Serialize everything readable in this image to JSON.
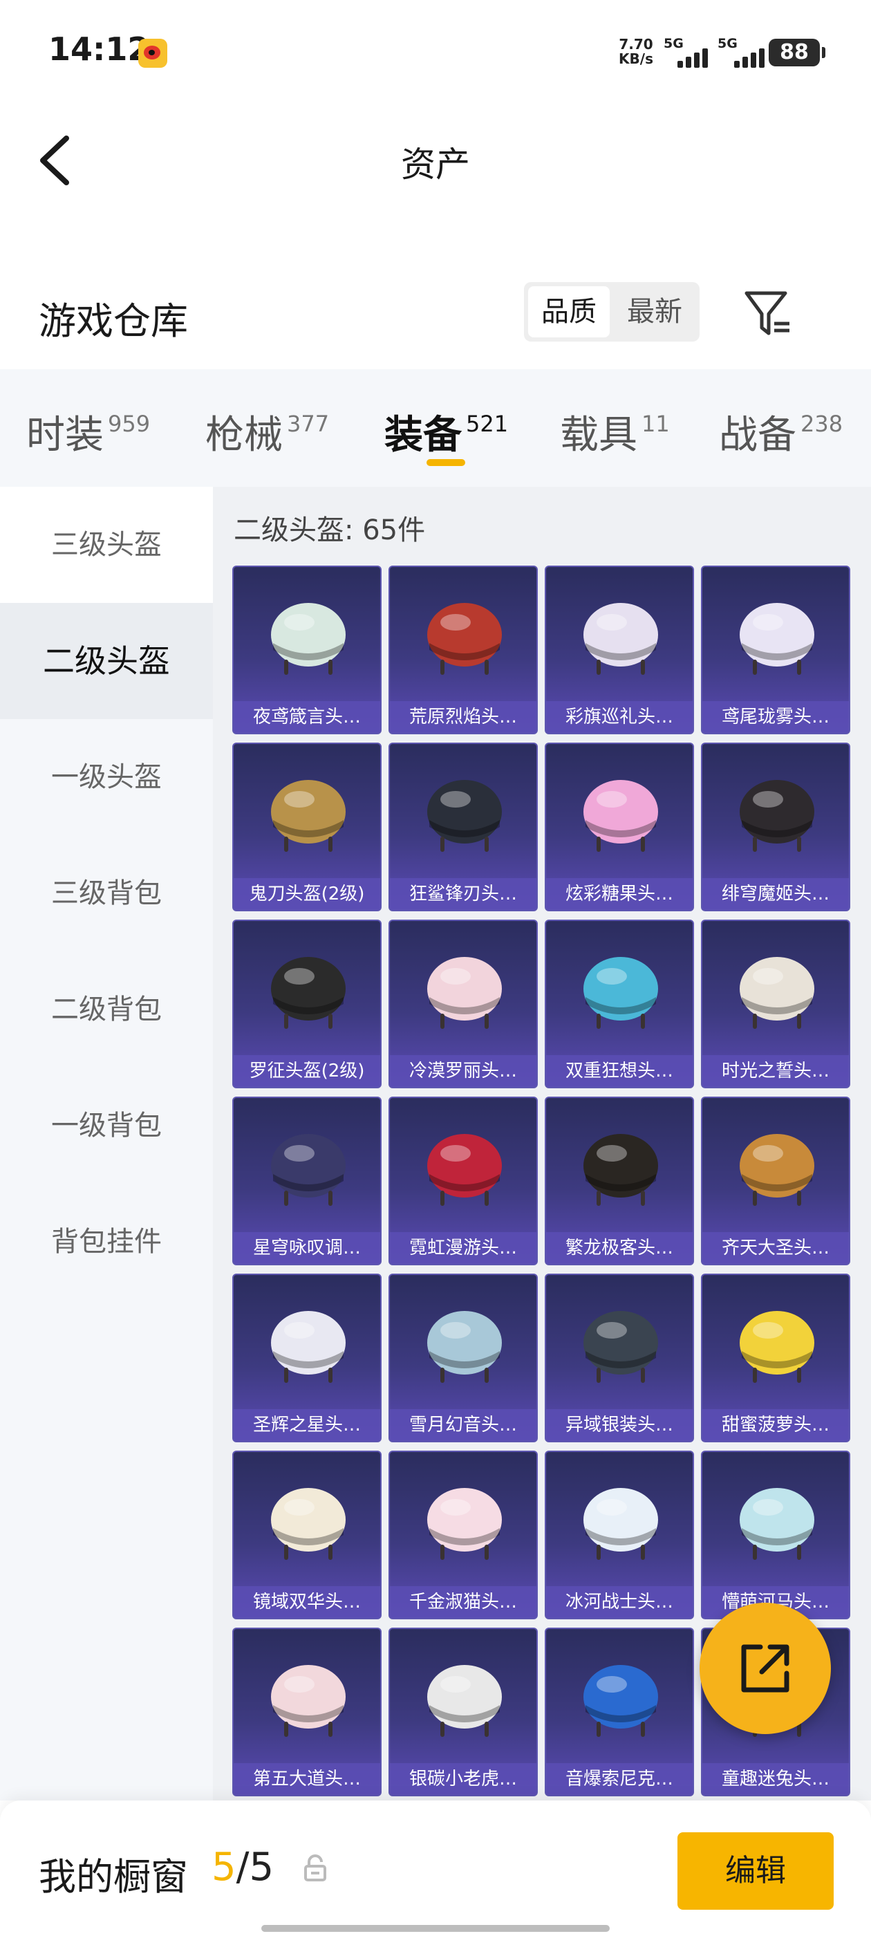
{
  "status_bar": {
    "time": "14:12",
    "app_icon": "weibo-icon",
    "net_speed_value": "7.70",
    "net_speed_unit": "KB/s",
    "signal1_label": "5G",
    "signal2_label": "5G",
    "battery": "88"
  },
  "header": {
    "title": "资产",
    "back_icon": "back-arrow-icon"
  },
  "warehouse": {
    "title": "游戏仓库",
    "sort_options": [
      "品质",
      "最新"
    ],
    "active_sort": "品质",
    "filter_icon": "filter-icon"
  },
  "tabs": [
    {
      "label": "时装",
      "count": "959"
    },
    {
      "label": "枪械",
      "count": "377"
    },
    {
      "label": "装备",
      "count": "521",
      "active": true
    },
    {
      "label": "载具",
      "count": "11"
    },
    {
      "label": "战备",
      "count": "238"
    }
  ],
  "sidebar": {
    "items": [
      {
        "label": "三级头盔"
      },
      {
        "label": "二级头盔",
        "active": true
      },
      {
        "label": "一级头盔"
      },
      {
        "label": "三级背包"
      },
      {
        "label": "二级背包"
      },
      {
        "label": "一级背包"
      },
      {
        "label": "背包挂件"
      }
    ]
  },
  "content": {
    "count_label": "二级头盔: 65件",
    "items": [
      {
        "name": "夜鸢箴言头…",
        "color": "#d8e8e0"
      },
      {
        "name": "荒原烈焰头…",
        "color": "#b83a2e"
      },
      {
        "name": "彩旗巡礼头…",
        "color": "#e6e0f0"
      },
      {
        "name": "鸢尾珑雾头…",
        "color": "#e8e4f4"
      },
      {
        "name": "鬼刀头盔(2级)",
        "color": "#b8924a"
      },
      {
        "name": "狂鲨锋刃头…",
        "color": "#2a2f3a"
      },
      {
        "name": "炫彩糖果头…",
        "color": "#f0a8d8"
      },
      {
        "name": "绯穹魔姬头…",
        "color": "#2e2a2e"
      },
      {
        "name": "罗征头盔(2级)",
        "color": "#2b2b2b"
      },
      {
        "name": "冷漠罗丽头…",
        "color": "#f2d4dc"
      },
      {
        "name": "双重狂想头…",
        "color": "#4bb8d8"
      },
      {
        "name": "时光之誓头…",
        "color": "#e8e2d8"
      },
      {
        "name": "星穹咏叹调…",
        "color": "#3a3a6a"
      },
      {
        "name": "霓虹漫游头…",
        "color": "#c0243a"
      },
      {
        "name": "繁龙极客头…",
        "color": "#2a2622"
      },
      {
        "name": "齐天大圣头…",
        "color": "#c88a3a"
      },
      {
        "name": "圣辉之星头…",
        "color": "#e8e8f2"
      },
      {
        "name": "雪月幻音头…",
        "color": "#a8c8d8"
      },
      {
        "name": "异域银装头…",
        "color": "#3a4450"
      },
      {
        "name": "甜蜜菠萝头…",
        "color": "#f2d23a"
      },
      {
        "name": "镜域双华头…",
        "color": "#f2ead8"
      },
      {
        "name": "千金淑猫头…",
        "color": "#f6dce4"
      },
      {
        "name": "冰河战士头…",
        "color": "#e8f0f8"
      },
      {
        "name": "懵萌河马头…",
        "color": "#bfe4ec"
      },
      {
        "name": "第五大道头…",
        "color": "#f2d8dc"
      },
      {
        "name": "银碳小老虎…",
        "color": "#e8e8e8"
      },
      {
        "name": "音爆索尼克…",
        "color": "#2a6ad0"
      },
      {
        "name": "童趣迷兔头…",
        "color": "#e8e0f0"
      }
    ]
  },
  "fab": {
    "icon": "share-icon"
  },
  "bottom_bar": {
    "label": "我的橱窗",
    "count_current": "5",
    "count_total": "/5",
    "lock_icon": "lock-icon",
    "edit_label": "编辑"
  }
}
